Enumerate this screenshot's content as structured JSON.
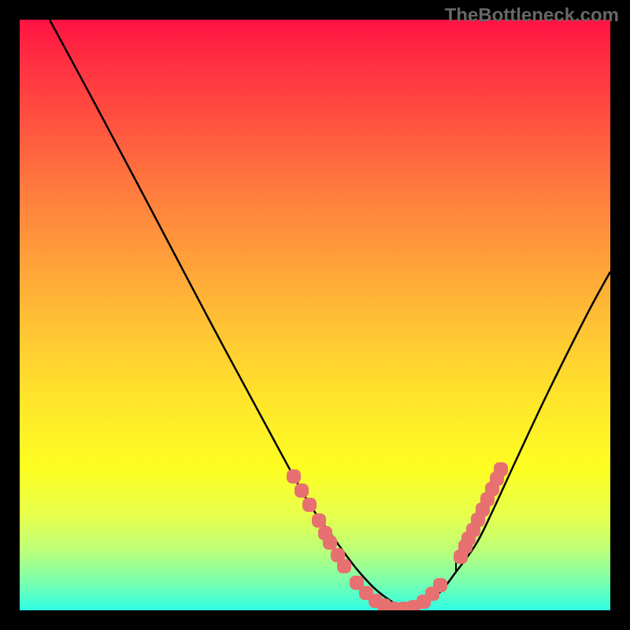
{
  "watermark": "TheBottleneck.com",
  "chart_data": {
    "type": "line",
    "title": "",
    "xlabel": "",
    "ylabel": "",
    "xlim": [
      0,
      750
    ],
    "ylim": [
      0,
      750
    ],
    "series": [
      {
        "name": "curve",
        "color": "#000000",
        "x": [
          38,
          100,
          170,
          240,
          310,
          365,
          400,
          430,
          460,
          495,
          530,
          555,
          580,
          600,
          630,
          670,
          720,
          750
        ],
        "y": [
          0,
          115,
          247,
          380,
          510,
          610,
          660,
          700,
          730,
          748,
          730,
          700,
          665,
          625,
          560,
          475,
          375,
          320
        ]
      }
    ],
    "markers": {
      "name": "highlight-dots",
      "color": "#e77070",
      "points": [
        {
          "x": 348,
          "y": 580
        },
        {
          "x": 358,
          "y": 598
        },
        {
          "x": 368,
          "y": 616
        },
        {
          "x": 380,
          "y": 636
        },
        {
          "x": 388,
          "y": 652
        },
        {
          "x": 394,
          "y": 664
        },
        {
          "x": 404,
          "y": 680
        },
        {
          "x": 412,
          "y": 694
        },
        {
          "x": 428,
          "y": 715
        },
        {
          "x": 440,
          "y": 728
        },
        {
          "x": 452,
          "y": 738
        },
        {
          "x": 463,
          "y": 744
        },
        {
          "x": 475,
          "y": 748
        },
        {
          "x": 488,
          "y": 748
        },
        {
          "x": 500,
          "y": 746
        },
        {
          "x": 513,
          "y": 739
        },
        {
          "x": 524,
          "y": 729
        },
        {
          "x": 534,
          "y": 718
        },
        {
          "x": 560,
          "y": 682
        },
        {
          "x": 566,
          "y": 669
        },
        {
          "x": 570,
          "y": 659
        },
        {
          "x": 576,
          "y": 648
        },
        {
          "x": 582,
          "y": 635
        },
        {
          "x": 588,
          "y": 622
        },
        {
          "x": 594,
          "y": 609
        },
        {
          "x": 600,
          "y": 596
        },
        {
          "x": 606,
          "y": 583
        },
        {
          "x": 611,
          "y": 571
        }
      ]
    },
    "ticks": [
      {
        "x": 554,
        "y": 695
      }
    ]
  }
}
